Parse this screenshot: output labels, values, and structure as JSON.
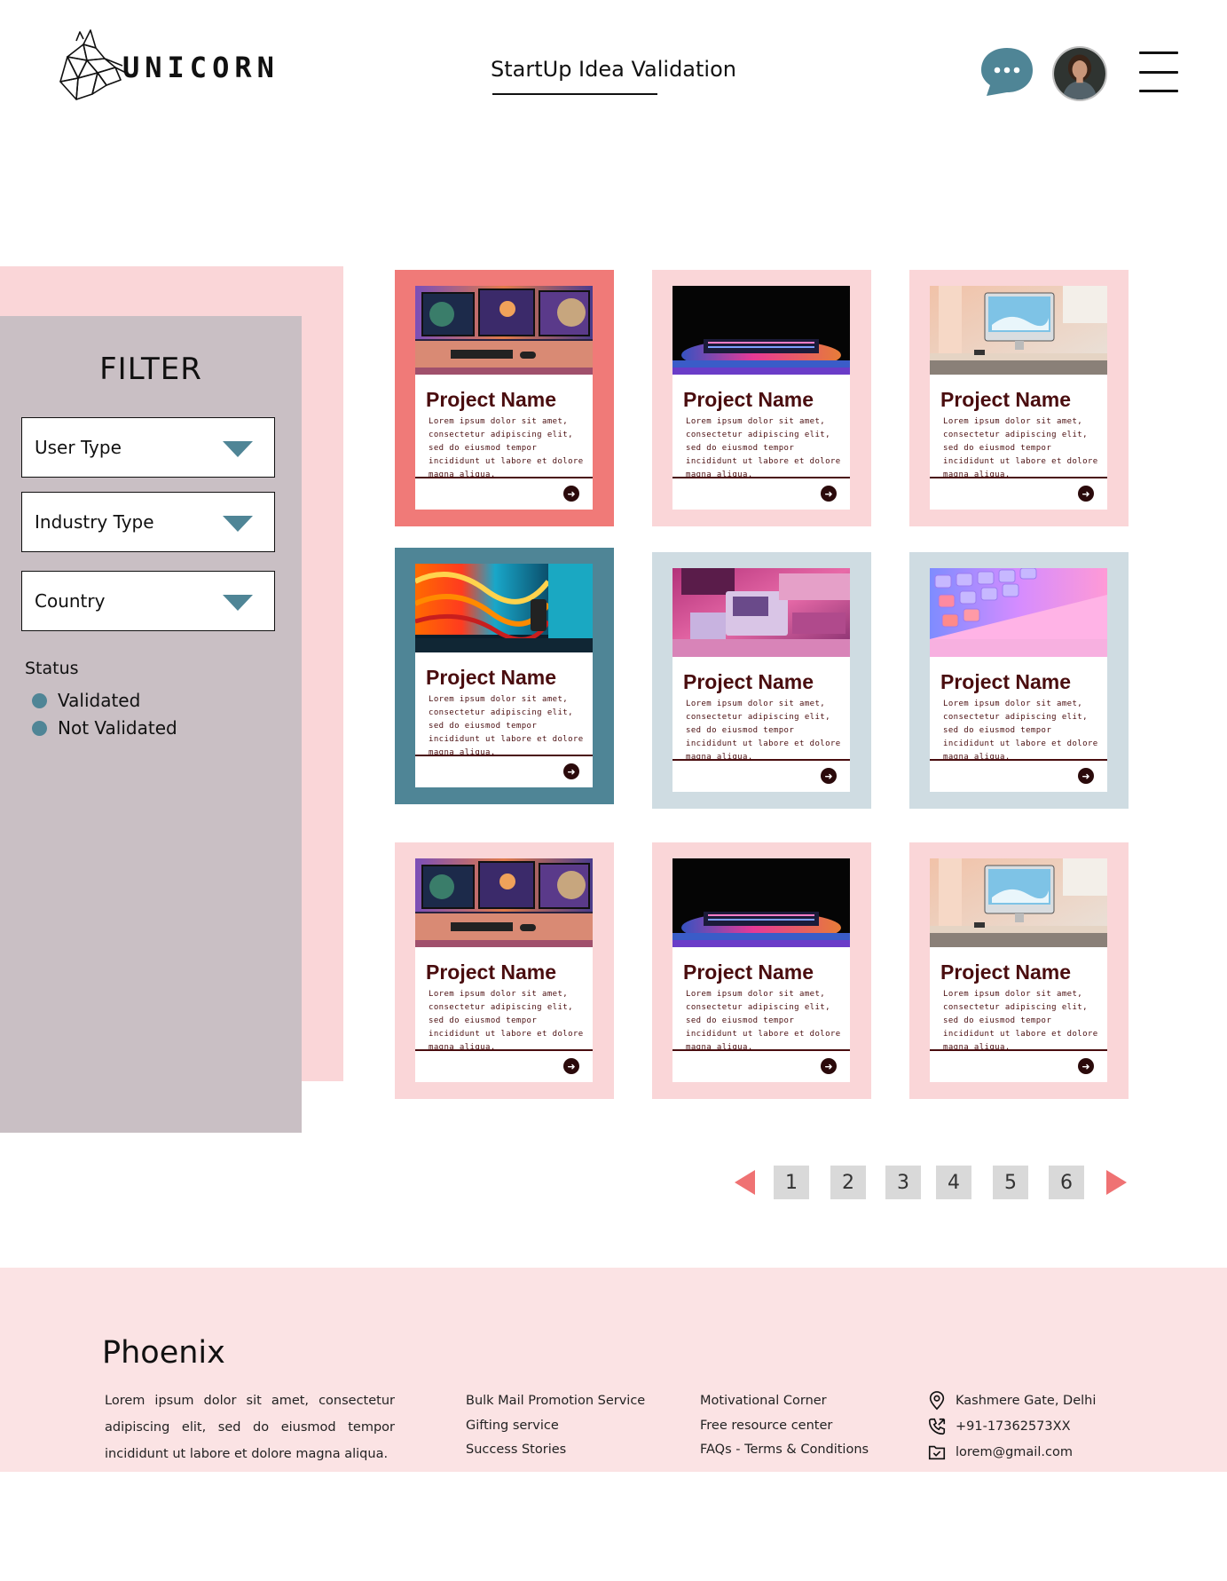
{
  "header": {
    "brand_name": "UNICORN",
    "page_title": "StartUp Idea Validation",
    "chat_icon": "chat-bubble-icon",
    "menu_icon": "hamburger-menu-icon"
  },
  "filter": {
    "title": "FILTER",
    "selects": [
      "User Type",
      "Industry Type",
      "Country"
    ],
    "status_label": "Status",
    "status_options": [
      "Validated",
      "Not Validated"
    ]
  },
  "cards": [
    {
      "name": "Project Name",
      "description": "Lorem ipsum dolor sit amet, consectetur adipiscing elit, sed do eiusmod tempor incididunt ut labore et dolore magna aliqua.",
      "frame_color": "#f07a78",
      "image": "monitors-setup"
    },
    {
      "name": "Project Name",
      "description": "Lorem ipsum dolor sit amet, consectetur adipiscing elit, sed do eiusmod tempor incididunt ut labore et dolore magna aliqua.",
      "frame_color": "#fad6d8",
      "image": "laptop-glow"
    },
    {
      "name": "Project Name",
      "description": "Lorem ipsum dolor sit amet, consectetur adipiscing elit, sed do eiusmod tempor incididunt ut labore et dolore magna aliqua.",
      "frame_color": "#fad6d8",
      "image": "imac-desk"
    },
    {
      "name": "Project Name",
      "description": "Lorem ipsum dolor sit amet, consectetur adipiscing elit, sed do eiusmod tempor incididunt ut labore et dolore magna aliqua.",
      "frame_color": "#4f8596",
      "image": "colorful-wallpaper"
    },
    {
      "name": "Project Name",
      "description": "Lorem ipsum dolor sit amet, consectetur adipiscing elit, sed do eiusmod tempor incididunt ut labore et dolore magna aliqua.",
      "frame_color": "#cfdce2",
      "image": "retro-computer"
    },
    {
      "name": "Project Name",
      "description": "Lorem ipsum dolor sit amet, consectetur adipiscing elit, sed do eiusmod tempor incididunt ut labore et dolore magna aliqua.",
      "frame_color": "#cfdce2",
      "image": "pink-keyboard"
    },
    {
      "name": "Project Name",
      "description": "Lorem ipsum dolor sit amet, consectetur adipiscing elit, sed do eiusmod tempor incididunt ut labore et dolore magna aliqua.",
      "frame_color": "#fad6d8",
      "image": "monitors-setup"
    },
    {
      "name": "Project Name",
      "description": "Lorem ipsum dolor sit amet, consectetur adipiscing elit, sed do eiusmod tempor incididunt ut labore et dolore magna aliqua.",
      "frame_color": "#fad6d8",
      "image": "laptop-glow"
    },
    {
      "name": "Project Name",
      "description": "Lorem ipsum dolor sit amet, consectetur adipiscing elit, sed do eiusmod tempor incididunt ut labore et dolore magna aliqua.",
      "frame_color": "#fad6d8",
      "image": "imac-desk"
    }
  ],
  "pagination": {
    "pages": [
      "1",
      "2",
      "3",
      "4",
      "5",
      "6"
    ],
    "prev_icon": "triangle-left-icon",
    "next_icon": "triangle-right-icon"
  },
  "footer": {
    "brand": "Phoenix",
    "about": "Lorem ipsum dolor sit amet, consectetur adipiscing elit, sed do eiusmod tempor incididunt ut labore et dolore magna aliqua.",
    "links_col1": [
      "Bulk Mail Promotion Service",
      "Gifting service",
      "Success Stories"
    ],
    "links_col2": [
      "Motivational Corner",
      "Free resource center",
      "FAQs - Terms & Conditions"
    ],
    "contact": {
      "address": "Kashmere Gate, Delhi",
      "phone": "+91-17362573XX",
      "email": "lorem@gmail.com"
    }
  },
  "colors": {
    "accent_teal": "#4f8596",
    "accent_coral": "#ef7273",
    "pink_light": "#fad6d8",
    "blue_light": "#cfdce2",
    "card_text": "#4a0d0f"
  }
}
